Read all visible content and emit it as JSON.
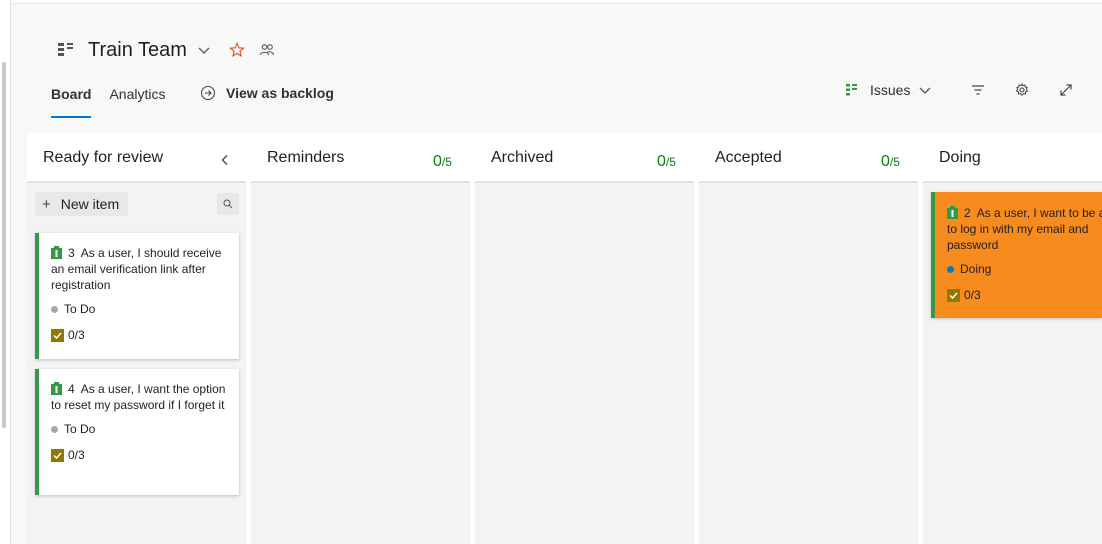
{
  "header": {
    "team_name": "Train Team"
  },
  "tabs": [
    {
      "label": "Board",
      "active": true
    },
    {
      "label": "Analytics",
      "active": false
    }
  ],
  "view_as_backlog": "View as backlog",
  "toolbar": {
    "issues_label": "Issues"
  },
  "columns": [
    {
      "title": "Ready for review",
      "count": "",
      "limit": ""
    },
    {
      "title": "Reminders",
      "count": "0",
      "limit": "/5"
    },
    {
      "title": "Archived",
      "count": "0",
      "limit": "/5"
    },
    {
      "title": "Accepted",
      "count": "0",
      "limit": "/5"
    },
    {
      "title": "Doing",
      "count": "",
      "limit": ""
    }
  ],
  "new_item_label": "New item",
  "cards": [
    {
      "id": "3",
      "title": "As a user, I should receive an email verification link after registration",
      "state": "To Do",
      "state_color": "#a6a6a6",
      "tasks": "0/3"
    },
    {
      "id": "4",
      "title": "As a user, I want the option to reset my password if I forget it",
      "state": "To Do",
      "state_color": "#a6a6a6",
      "tasks": "0/3"
    },
    {
      "id": "2",
      "title": "As a user, I want to be able to log in with my email and password",
      "state": "Doing",
      "state_color": "#0078d4",
      "tasks": "0/3"
    }
  ],
  "colors": {
    "accent": "#0078d4",
    "card_bar": "#339947",
    "count_green": "#107c10",
    "doing_card": "#f78b1e"
  }
}
